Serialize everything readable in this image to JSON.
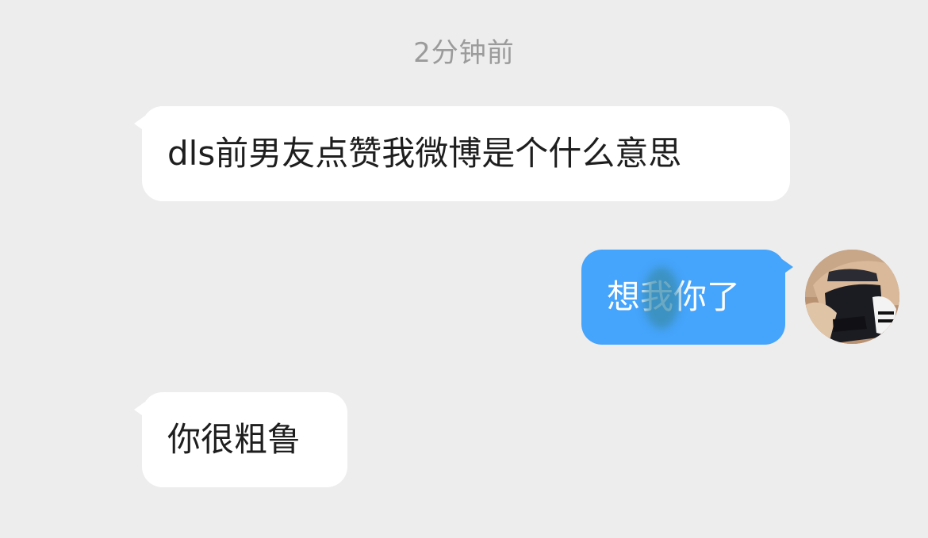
{
  "chat": {
    "timestamp": "2分钟前",
    "messages": [
      {
        "direction": "incoming",
        "text": "dls前男友点赞我微博是个什么意思"
      },
      {
        "direction": "outgoing",
        "text": "想我你了"
      },
      {
        "direction": "incoming",
        "text": "你很粗鲁"
      }
    ]
  },
  "colors": {
    "background": "#ededed",
    "incoming_bubble": "#ffffff",
    "outgoing_bubble": "#45a4fb",
    "timestamp_text": "#9b9b9b"
  },
  "icons": {
    "avatar": "user-avatar-photo-icon"
  }
}
